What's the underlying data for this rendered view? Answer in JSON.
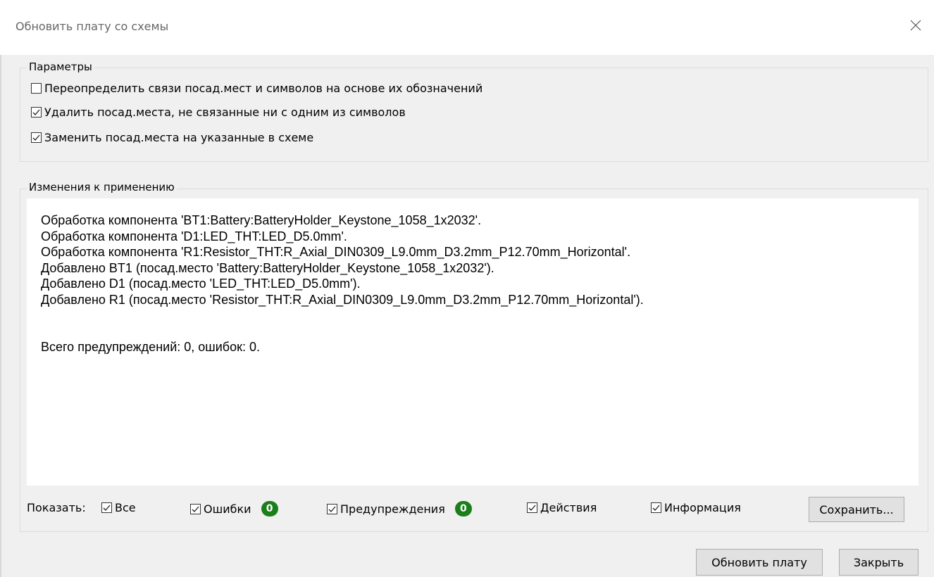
{
  "window": {
    "title": "Обновить плату со схемы",
    "close_icon": "close-icon"
  },
  "params": {
    "label": "Параметры",
    "options": [
      {
        "label": "Переопределить связи посад.мест и символов на основе их обозначений",
        "checked": false
      },
      {
        "label": "Удалить посад.места, не связанные ни с одним из символов",
        "checked": true
      },
      {
        "label": "Заменить посад.места на указанные в схеме",
        "checked": true
      }
    ]
  },
  "changes": {
    "label": "Изменения к применению",
    "log_lines": [
      "Обработка компонента 'BT1:Battery:BatteryHolder_Keystone_1058_1x2032'.",
      "Обработка компонента 'D1:LED_THT:LED_D5.0mm'.",
      "Обработка компонента 'R1:Resistor_THT:R_Axial_DIN0309_L9.0mm_D3.2mm_P12.70mm_Horizontal'.",
      "Добавлено BT1 (посад.место 'Battery:BatteryHolder_Keystone_1058_1x2032').",
      "Добавлено D1 (посад.место 'LED_THT:LED_D5.0mm').",
      "Добавлено R1 (посад.место 'Resistor_THT:R_Axial_DIN0309_L9.0mm_D3.2mm_P12.70mm_Horizontal')."
    ],
    "summary": "Всего предупреждений: 0, ошибок: 0."
  },
  "filters": {
    "show_label": "Показать:",
    "all": {
      "label": "Все",
      "checked": true
    },
    "errors": {
      "label": "Ошибки",
      "checked": true,
      "count": "0"
    },
    "warnings": {
      "label": "Предупреждения",
      "checked": true,
      "count": "0"
    },
    "actions": {
      "label": "Действия",
      "checked": true
    },
    "info": {
      "label": "Информация",
      "checked": true
    },
    "badge_color": "#1a7f1a"
  },
  "buttons": {
    "save": "Сохранить...",
    "update": "Обновить плату",
    "close": "Закрыть"
  }
}
